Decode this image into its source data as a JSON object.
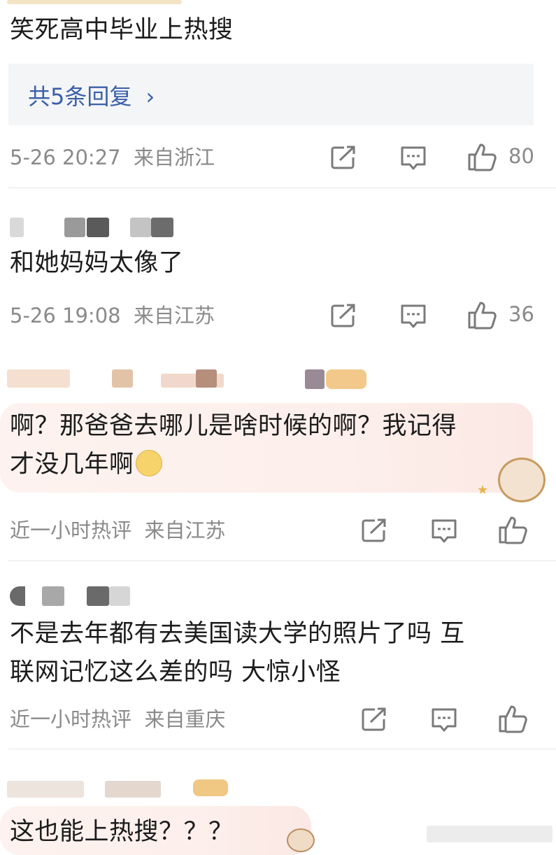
{
  "comments": [
    {
      "text": "笑死高中毕业上热搜",
      "reply_link": "共5条回复",
      "time": "5-26 20:27",
      "location": "来自浙江",
      "likes": "80"
    },
    {
      "text": "和她妈妈太像了",
      "time": "5-26 19:08",
      "location": "来自江苏",
      "likes": "36"
    },
    {
      "text_line1": "啊？那爸爸去哪儿是啥时候的啊？我记得",
      "text_line2": "才没几年啊",
      "emoji": "sweat-smile-emoji",
      "time": "近一小时热评",
      "location": "来自江苏"
    },
    {
      "text_line1": "不是去年都有去美国读大学的照片了吗 互",
      "text_line2": "联网记忆这么差的吗 大惊小怪",
      "time": "近一小时热评",
      "location": "来自重庆"
    },
    {
      "text": "这也能上热搜？？？"
    }
  ],
  "icons": {
    "share": "share-icon",
    "comment": "comment-icon",
    "like": "thumbs-up-icon"
  },
  "colors": {
    "link": "#3b5fa8",
    "meta": "#8a8a8a",
    "bubble": "#fdf0ec"
  }
}
